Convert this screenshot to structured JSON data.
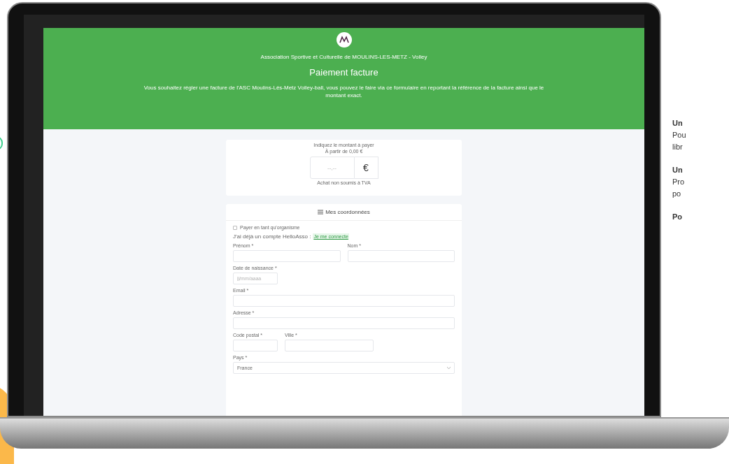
{
  "page": {
    "organization": "Association Sportive et Culturelle de MOULINS-LES-METZ - Volley",
    "title": "Paiement facture",
    "intro": "Vous souhaitez régler une facture de l'ASC Moulins-Lès-Metz Volley-ball, vous pouvez le faire via ce formulaire en reportant la référence de la facture ainsi que le montant exact.",
    "amount": {
      "label": "Indiquez le montant à payer",
      "minimum": "À partir de 0,00 €",
      "placeholder": "--,--",
      "currency": "€",
      "note": "Achat non soumis à TVA"
    },
    "contact": {
      "title": "Mes coordonnées",
      "organization_checkbox": {
        "label": "Payer en tant qu'organisme",
        "checked": false
      },
      "account_text": "J'ai déjà un compte HelloAsso :",
      "login_link": "Je me connecte",
      "rows": [
        [
          {
            "label": "Prénom *",
            "kind": "text"
          },
          {
            "label": "Nom *",
            "kind": "text"
          }
        ],
        [
          {
            "label": "Date de naissance *",
            "kind": "date",
            "placeholder": "jj/mm/aaaa"
          }
        ],
        [
          {
            "label": "Email *",
            "kind": "text"
          }
        ],
        [
          {
            "label": "Adresse *",
            "kind": "text"
          }
        ],
        [
          {
            "label": "Code postal *",
            "kind": "postal_code"
          },
          {
            "label": "Ville *",
            "kind": "city"
          }
        ],
        [
          {
            "label": "Pays *",
            "kind": "select",
            "value": "France"
          }
        ]
      ]
    }
  },
  "side_text": [
    {
      "heading": "Un",
      "lines": [
        "Pou",
        "libr"
      ]
    },
    {
      "heading": "Un",
      "lines": [
        "Pro",
        "po"
      ]
    },
    {
      "heading": "Po"
    }
  ]
}
